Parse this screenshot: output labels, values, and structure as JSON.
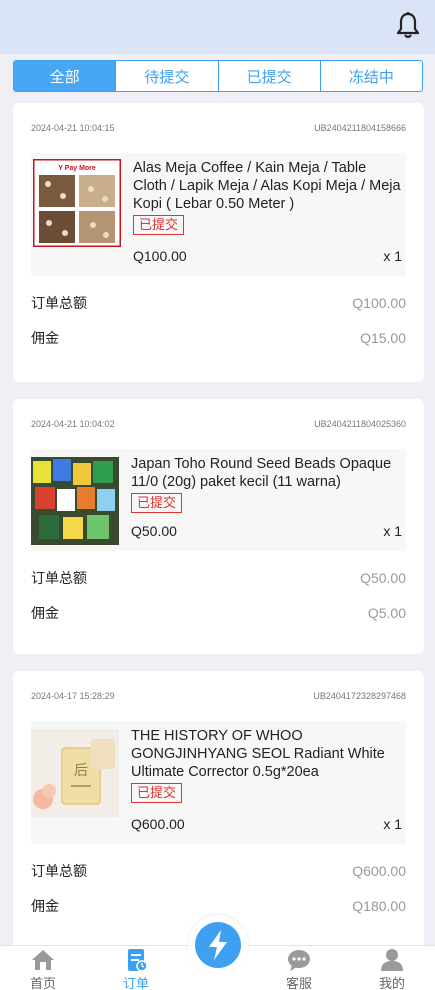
{
  "tabs": [
    {
      "label": "全部",
      "active": true
    },
    {
      "label": "待提交",
      "active": false
    },
    {
      "label": "已提交",
      "active": false
    },
    {
      "label": "冻结中",
      "active": false
    }
  ],
  "orders": [
    {
      "time": "2024-04-21 10:04:15",
      "id": "UB2404211804158666",
      "title": "Alas Meja Coffee / Kain Meja / Table Cloth / Lapik Meja / Alas Kopi Meja / Meja Kopi ( Lebar 0.50 Meter )",
      "status": "已提交",
      "price": "Q100.00",
      "qty": "x 1",
      "total_label": "订单总额",
      "total": "Q100.00",
      "commission_label": "佣金",
      "commission": "Q15.00",
      "image_text": "Y Pay More"
    },
    {
      "time": "2024-04-21 10:04:02",
      "id": "UB2404211804025360",
      "title": "Japan Toho Round Seed Beads Opaque 11/0 (20g) paket kecil (11 warna)",
      "status": "已提交",
      "price": "Q50.00",
      "qty": "x 1",
      "total_label": "订单总额",
      "total": "Q50.00",
      "commission_label": "佣金",
      "commission": "Q5.00"
    },
    {
      "time": "2024-04-17 15:28:29",
      "id": "UB2404172328297468",
      "title": "THE HISTORY OF WHOO GONGJINHYANG SEOL Radiant White Ultimate Corrector 0.5g*20ea",
      "status": "已提交",
      "price": "Q600.00",
      "qty": "x 1",
      "total_label": "订单总额",
      "total": "Q600.00",
      "commission_label": "佣金",
      "commission": "Q180.00"
    }
  ],
  "bottom_nav": [
    {
      "label": "首页",
      "icon": "home-icon",
      "active": false
    },
    {
      "label": "订单",
      "icon": "order-icon",
      "active": true
    },
    {
      "label": "",
      "icon": "lightning-icon",
      "active": false
    },
    {
      "label": "客服",
      "icon": "chat-icon",
      "active": false
    },
    {
      "label": "我的",
      "icon": "user-icon",
      "active": false
    }
  ],
  "colors": {
    "accent": "#3ea0f0",
    "header_bg": "#dbe3f7",
    "badge": "#d33333"
  }
}
